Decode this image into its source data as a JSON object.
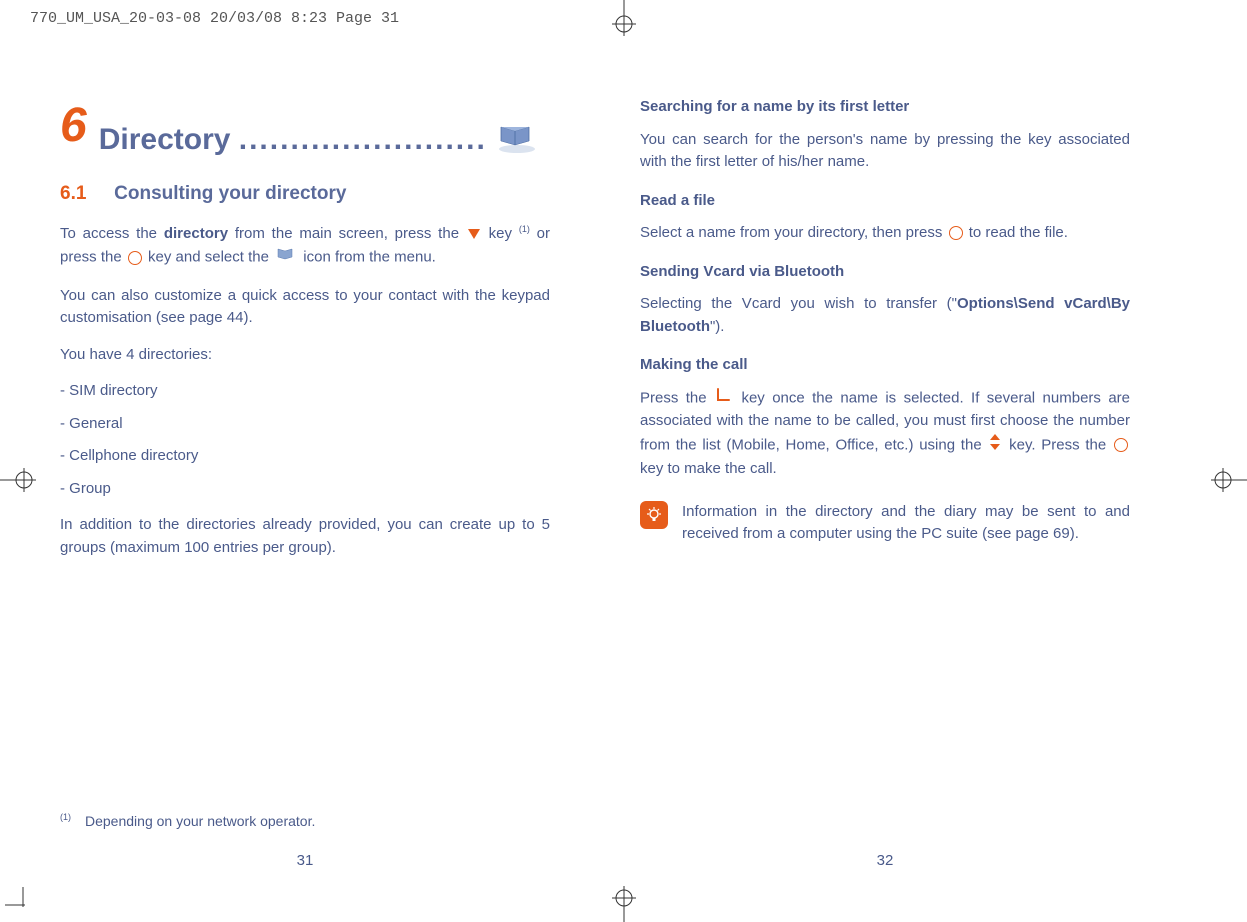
{
  "header": {
    "info": "770_UM_USA_20-03-08  20/03/08  8:23  Page 31"
  },
  "left_page": {
    "chapter_num": "6",
    "chapter_title": "Directory",
    "chapter_dots": "........................",
    "section_num": "6.1",
    "section_title": "Consulting your directory",
    "para1_a": "To access the ",
    "para1_b": "directory",
    "para1_c": " from the main screen, press the ",
    "para1_d": " key ",
    "para1_e": " or press the ",
    "para1_f": " key and select the ",
    "para1_g": " icon from the menu.",
    "footnote_ref": "(1)",
    "para2": "You can also customize a quick access to your contact with the keypad customisation (see page 44).",
    "para3": "You have 4 directories:",
    "list": [
      "- SIM directory",
      "- General",
      "- Cellphone directory",
      "- Group"
    ],
    "para4": "In addition to the directories already provided, you can create up to 5 groups (maximum 100 entries per group).",
    "footnote_num": "(1)",
    "footnote_text": "Depending on your network operator.",
    "page_number": "31"
  },
  "right_page": {
    "h1": "Searching for a name by its first letter",
    "p1": "You can search for the person's name by pressing the key associated with the first letter of his/her name.",
    "h2": "Read a file",
    "p2a": "Select a name from your directory, then press ",
    "p2b": " to read the file.",
    "h3": "Sending Vcard via Bluetooth",
    "p3a": "Selecting the Vcard you wish to transfer (\"",
    "p3b": "Options\\Send vCard\\By Bluetooth",
    "p3c": "\").",
    "h4": "Making the call",
    "p4a": "Press the ",
    "p4b": " key once the name is selected. If several numbers are associated with the name to be called, you must first choose the number from the list (Mobile, Home, Office, etc.) using the ",
    "p4c": " key. Press the ",
    "p4d": " key to make the call.",
    "tip_text": "Information in the directory and the diary may be sent to and received from a computer using the PC suite (see page 69).",
    "page_number": "32"
  }
}
